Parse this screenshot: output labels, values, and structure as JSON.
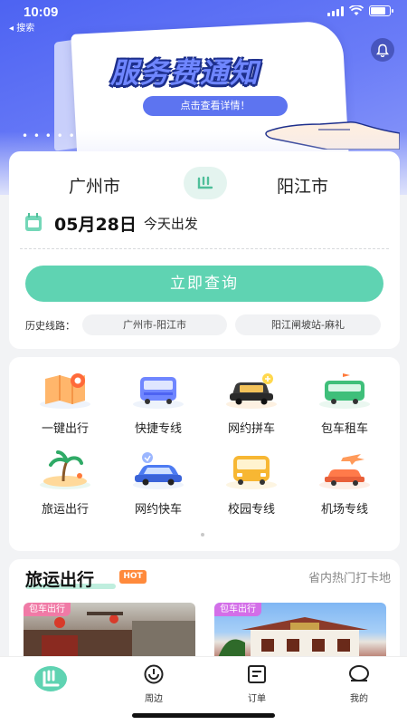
{
  "status_bar": {
    "time": "10:09",
    "back_label": "◂ 搜索"
  },
  "banner": {
    "title": "服务费通知",
    "button_label": "点击查看详情！",
    "dots": "• • • • •"
  },
  "search": {
    "from_city": "广州市",
    "to_city": "阳江市",
    "date": "05月28日",
    "date_note": "今天出发",
    "query_button": "立即查询",
    "history_label": "历史线路：",
    "history": [
      "广州市-阳江市",
      "阳江闸坡站-麻礼"
    ]
  },
  "services": [
    {
      "label": "一键出行",
      "icon": "map-pin-icon"
    },
    {
      "label": "快捷专线",
      "icon": "bus-icon"
    },
    {
      "label": "网约拼车",
      "icon": "carpool-icon"
    },
    {
      "label": "包车租车",
      "icon": "charter-bus-icon"
    },
    {
      "label": "旅运出行",
      "icon": "palm-tree-icon"
    },
    {
      "label": "网约快车",
      "icon": "express-car-icon"
    },
    {
      "label": "校园专线",
      "icon": "school-bus-icon"
    },
    {
      "label": "机场专线",
      "icon": "airport-icon"
    }
  ],
  "travel": {
    "title": "旅运出行",
    "badge": "HOT",
    "more": "省内热门打卡地",
    "cards": [
      {
        "tag": "包车出行"
      },
      {
        "tag": "包车出行"
      }
    ]
  },
  "tabs": [
    {
      "label": "",
      "icon": "home-logo-icon"
    },
    {
      "label": "周边",
      "icon": "nearby-icon"
    },
    {
      "label": "订单",
      "icon": "orders-icon"
    },
    {
      "label": "我的",
      "icon": "profile-icon"
    }
  ],
  "colors": {
    "brand": "#5fd3b2",
    "banner": "#4d63f2",
    "hot": "#ff8a3c"
  }
}
